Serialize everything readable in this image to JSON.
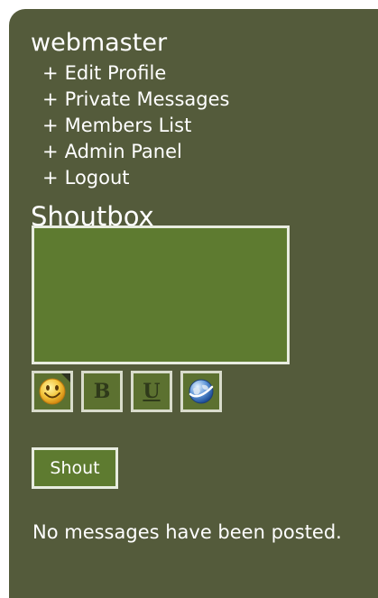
{
  "user": {
    "name": "webmaster"
  },
  "nav": {
    "items": [
      {
        "prefix": "+",
        "label": "Edit Profile"
      },
      {
        "prefix": "+",
        "label": "Private Messages"
      },
      {
        "prefix": "+",
        "label": "Members List"
      },
      {
        "prefix": "+",
        "label": "Admin Panel"
      },
      {
        "prefix": "+",
        "label": "Logout"
      }
    ]
  },
  "shoutbox": {
    "title": "Shoutbox",
    "message_value": "",
    "toolbar": {
      "smiley_icon": "smiley-icon",
      "bold_label": "B",
      "underline_label": "U",
      "link_icon": "globe-link-icon"
    },
    "shout_label": "Shout",
    "status": "No messages have been posted."
  },
  "colors": {
    "panel_bg": "#545b3b",
    "input_bg": "#5e7b30",
    "border": "#e8ece0",
    "text": "#ffffff"
  }
}
